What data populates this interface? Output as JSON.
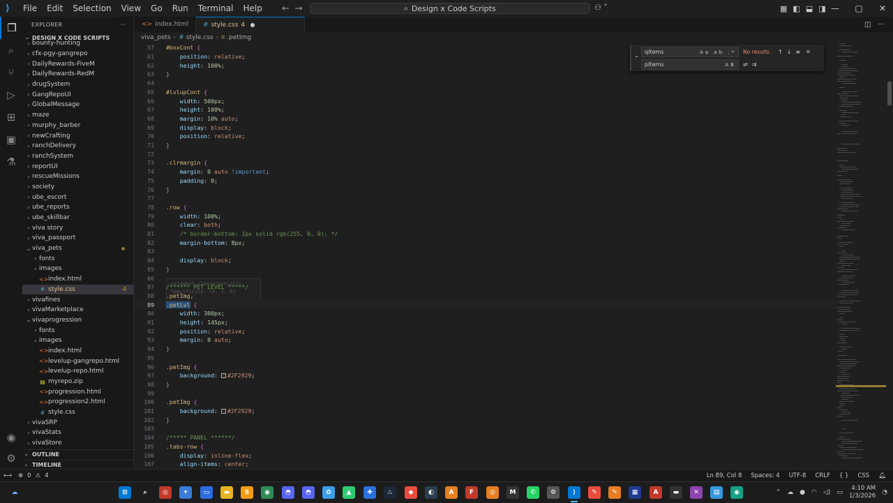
{
  "menu": [
    "File",
    "Edit",
    "Selection",
    "View",
    "Go",
    "Run",
    "Terminal",
    "Help"
  ],
  "command_center": "Design x Code Scripts",
  "explorer": {
    "title": "EXPLORER",
    "root": "DESIGN X CODE SCRIPTS",
    "items": [
      {
        "label": "bounty-hunting",
        "kind": "folder",
        "depth": 1
      },
      {
        "label": "cfx-pgy-gangrepo",
        "kind": "folder",
        "depth": 1
      },
      {
        "label": "DailyRewards-FiveM",
        "kind": "folder",
        "depth": 1
      },
      {
        "label": "DailyRewards-RedM",
        "kind": "folder",
        "depth": 1
      },
      {
        "label": "drugSystem",
        "kind": "folder",
        "depth": 1
      },
      {
        "label": "GangRepoUI",
        "kind": "folder",
        "depth": 1
      },
      {
        "label": "GlobalMessage",
        "kind": "folder",
        "depth": 1
      },
      {
        "label": "maze",
        "kind": "folder",
        "depth": 1
      },
      {
        "label": "murphy_barber",
        "kind": "folder",
        "depth": 1
      },
      {
        "label": "newCrafting",
        "kind": "folder",
        "depth": 1
      },
      {
        "label": "ranchDelivery",
        "kind": "folder",
        "depth": 1
      },
      {
        "label": "ranchSystem",
        "kind": "folder",
        "depth": 1
      },
      {
        "label": "reportUI",
        "kind": "folder",
        "depth": 1
      },
      {
        "label": "rescueMissions",
        "kind": "folder",
        "depth": 1
      },
      {
        "label": "society",
        "kind": "folder",
        "depth": 1
      },
      {
        "label": "ube_escort",
        "kind": "folder",
        "depth": 1
      },
      {
        "label": "ube_reports",
        "kind": "folder",
        "depth": 1
      },
      {
        "label": "ube_skillbar",
        "kind": "folder",
        "depth": 1
      },
      {
        "label": "viva story",
        "kind": "folder",
        "depth": 1
      },
      {
        "label": "viva_passport",
        "kind": "folder",
        "depth": 1
      },
      {
        "label": "viva_pets",
        "kind": "folder-open",
        "depth": 1,
        "dot": true
      },
      {
        "label": "fonts",
        "kind": "folder",
        "depth": 2
      },
      {
        "label": "images",
        "kind": "folder",
        "depth": 2
      },
      {
        "label": "index.html",
        "kind": "html",
        "depth": 2
      },
      {
        "label": "style.css",
        "kind": "css",
        "depth": 2,
        "selected": true,
        "badge": "4"
      },
      {
        "label": "vivafines",
        "kind": "folder",
        "depth": 1
      },
      {
        "label": "vivaMarketplace",
        "kind": "folder",
        "depth": 1
      },
      {
        "label": "vivaprogression",
        "kind": "folder-open",
        "depth": 1
      },
      {
        "label": "fonts",
        "kind": "folder",
        "depth": 2
      },
      {
        "label": "images",
        "kind": "folder",
        "depth": 2
      },
      {
        "label": "index.html",
        "kind": "html",
        "depth": 2
      },
      {
        "label": "levelup-gangrepo.html",
        "kind": "html",
        "depth": 2
      },
      {
        "label": "levelup-repo.html",
        "kind": "html",
        "depth": 2
      },
      {
        "label": "myrepo.zip",
        "kind": "zip",
        "depth": 2
      },
      {
        "label": "progression.html",
        "kind": "html",
        "depth": 2
      },
      {
        "label": "progression2.html",
        "kind": "html",
        "depth": 2
      },
      {
        "label": "style.css",
        "kind": "css",
        "depth": 2
      },
      {
        "label": "vivaSRP",
        "kind": "folder",
        "depth": 1
      },
      {
        "label": "vivaStats",
        "kind": "folder",
        "depth": 1
      },
      {
        "label": "vivaStore",
        "kind": "folder",
        "depth": 1
      }
    ],
    "outline": "OUTLINE",
    "timeline": "TIMELINE"
  },
  "tabs": [
    {
      "label": "index.html",
      "active": false
    },
    {
      "label": "style.css",
      "badge": "4",
      "active": true
    }
  ],
  "breadcrumb": [
    "viva_pets",
    "style.css",
    ".petImg"
  ],
  "find": {
    "query": "qItems",
    "replace": "pItems",
    "status": "No results",
    "find_opts": "Aa ab .*",
    "replace_opts": "AB"
  },
  "hover": {
    "line1": "<element class=\"petLvl\">",
    "line2": "Specificity: (0, 1, 0)"
  },
  "code": [
    {
      "n": "57",
      "t": [
        [
          "sel",
          "#boxCont "
        ],
        [
          "brace",
          "{"
        ]
      ]
    },
    {
      "n": "61",
      "t": [
        [
          "plain",
          "    "
        ],
        [
          "prop",
          "position"
        ],
        [
          "plain",
          ": "
        ],
        [
          "val",
          "relative"
        ],
        [
          "plain",
          ";"
        ]
      ]
    },
    {
      "n": "62",
      "t": [
        [
          "plain",
          "    "
        ],
        [
          "prop",
          "height"
        ],
        [
          "plain",
          ": "
        ],
        [
          "num",
          "100%"
        ],
        [
          "plain",
          ";"
        ]
      ]
    },
    {
      "n": "63",
      "t": [
        [
          "brace",
          "}"
        ]
      ]
    },
    {
      "n": "64",
      "t": []
    },
    {
      "n": "65",
      "t": [
        [
          "sel",
          "#lvlupCont "
        ],
        [
          "brace",
          "{"
        ]
      ]
    },
    {
      "n": "66",
      "t": [
        [
          "plain",
          "    "
        ],
        [
          "prop",
          "width"
        ],
        [
          "plain",
          ": "
        ],
        [
          "num",
          "500px"
        ],
        [
          "plain",
          ";"
        ]
      ]
    },
    {
      "n": "67",
      "t": [
        [
          "plain",
          "    "
        ],
        [
          "prop",
          "height"
        ],
        [
          "plain",
          ": "
        ],
        [
          "num",
          "100%"
        ],
        [
          "plain",
          ";"
        ]
      ]
    },
    {
      "n": "68",
      "t": [
        [
          "plain",
          "    "
        ],
        [
          "prop",
          "margin"
        ],
        [
          "plain",
          ": "
        ],
        [
          "num",
          "10%"
        ],
        [
          "plain",
          " "
        ],
        [
          "val",
          "auto"
        ],
        [
          "plain",
          ";"
        ]
      ]
    },
    {
      "n": "69",
      "t": [
        [
          "plain",
          "    "
        ],
        [
          "prop",
          "display"
        ],
        [
          "plain",
          ": "
        ],
        [
          "val",
          "block"
        ],
        [
          "plain",
          ";"
        ]
      ]
    },
    {
      "n": "70",
      "t": [
        [
          "plain",
          "    "
        ],
        [
          "prop",
          "position"
        ],
        [
          "plain",
          ": "
        ],
        [
          "val",
          "relative"
        ],
        [
          "plain",
          ";"
        ]
      ]
    },
    {
      "n": "71",
      "t": [
        [
          "brace",
          "}"
        ]
      ]
    },
    {
      "n": "72",
      "t": []
    },
    {
      "n": "73",
      "t": [
        [
          "sel",
          ".clrmargin "
        ],
        [
          "brace",
          "{"
        ]
      ]
    },
    {
      "n": "74",
      "t": [
        [
          "plain",
          "    "
        ],
        [
          "prop",
          "margin"
        ],
        [
          "plain",
          ": "
        ],
        [
          "num",
          "0"
        ],
        [
          "plain",
          " "
        ],
        [
          "val",
          "auto"
        ],
        [
          "plain",
          " "
        ],
        [
          "kw",
          "!important"
        ],
        [
          "plain",
          ";"
        ]
      ]
    },
    {
      "n": "75",
      "t": [
        [
          "plain",
          "    "
        ],
        [
          "prop",
          "padding"
        ],
        [
          "plain",
          ": "
        ],
        [
          "num",
          "0"
        ],
        [
          "plain",
          ";"
        ]
      ]
    },
    {
      "n": "76",
      "t": [
        [
          "brace",
          "}"
        ]
      ]
    },
    {
      "n": "77",
      "t": []
    },
    {
      "n": "78",
      "t": [
        [
          "sel",
          ".row "
        ],
        [
          "brace",
          "{"
        ]
      ]
    },
    {
      "n": "79",
      "t": [
        [
          "plain",
          "    "
        ],
        [
          "prop",
          "width"
        ],
        [
          "plain",
          ": "
        ],
        [
          "num",
          "100%"
        ],
        [
          "plain",
          ";"
        ]
      ]
    },
    {
      "n": "80",
      "t": [
        [
          "plain",
          "    "
        ],
        [
          "prop",
          "clear"
        ],
        [
          "plain",
          ": "
        ],
        [
          "val",
          "both"
        ],
        [
          "plain",
          ";"
        ]
      ]
    },
    {
      "n": "81",
      "t": [
        [
          "plain",
          "    "
        ],
        [
          "com",
          "/* border-bottom: 1px solid rgb(255, 0, 0); */"
        ]
      ]
    },
    {
      "n": "82",
      "t": [
        [
          "plain",
          "    "
        ],
        [
          "prop",
          "margin-bottom"
        ],
        [
          "plain",
          ": "
        ],
        [
          "num",
          "8px"
        ],
        [
          "plain",
          ";"
        ]
      ]
    },
    {
      "n": "83",
      "t": []
    },
    {
      "n": "84",
      "t": [
        [
          "plain",
          "    "
        ],
        [
          "prop",
          "display"
        ],
        [
          "plain",
          ": "
        ],
        [
          "val",
          "block"
        ],
        [
          "plain",
          ";"
        ]
      ]
    },
    {
      "n": "85",
      "t": [
        [
          "brace",
          "}"
        ]
      ]
    },
    {
      "n": "86",
      "t": []
    },
    {
      "n": "87",
      "t": [
        [
          "com",
          "/****** PET LEVEL *****/"
        ]
      ]
    },
    {
      "n": "88",
      "t": [
        [
          "sel",
          ".petImg"
        ],
        [
          "plain",
          ","
        ]
      ]
    },
    {
      "n": "89",
      "t": [
        [
          "hlsel",
          ".petLvl"
        ],
        [
          "plain",
          " "
        ],
        [
          "brace",
          "{"
        ]
      ],
      "cur": true
    },
    {
      "n": "90",
      "t": [
        [
          "plain",
          "    "
        ],
        [
          "prop",
          "width"
        ],
        [
          "plain",
          ": "
        ],
        [
          "num",
          "300px"
        ],
        [
          "plain",
          ";"
        ]
      ]
    },
    {
      "n": "91",
      "t": [
        [
          "plain",
          "    "
        ],
        [
          "prop",
          "height"
        ],
        [
          "plain",
          ": "
        ],
        [
          "num",
          "145px"
        ],
        [
          "plain",
          ";"
        ]
      ]
    },
    {
      "n": "92",
      "t": [
        [
          "plain",
          "    "
        ],
        [
          "prop",
          "position"
        ],
        [
          "plain",
          ": "
        ],
        [
          "val",
          "relative"
        ],
        [
          "plain",
          ";"
        ]
      ]
    },
    {
      "n": "93",
      "t": [
        [
          "plain",
          "    "
        ],
        [
          "prop",
          "margin"
        ],
        [
          "plain",
          ": "
        ],
        [
          "num",
          "0"
        ],
        [
          "plain",
          " "
        ],
        [
          "val",
          "auto"
        ],
        [
          "plain",
          ";"
        ]
      ]
    },
    {
      "n": "94",
      "t": [
        [
          "brace",
          "}"
        ]
      ]
    },
    {
      "n": "95",
      "t": []
    },
    {
      "n": "96",
      "t": [
        [
          "sel",
          ".petImg "
        ],
        [
          "brace",
          "{"
        ]
      ]
    },
    {
      "n": "97",
      "t": [
        [
          "plain",
          "    "
        ],
        [
          "prop",
          "background"
        ],
        [
          "plain",
          ": "
        ],
        [
          "swatch",
          ""
        ],
        [
          "val",
          "#2F2929"
        ],
        [
          "plain",
          ";"
        ]
      ]
    },
    {
      "n": "98",
      "t": [
        [
          "brace",
          "}"
        ]
      ]
    },
    {
      "n": "99",
      "t": []
    },
    {
      "n": "100",
      "t": [
        [
          "sel",
          ".petImg "
        ],
        [
          "brace",
          "{"
        ]
      ]
    },
    {
      "n": "101",
      "t": [
        [
          "plain",
          "    "
        ],
        [
          "prop",
          "background"
        ],
        [
          "plain",
          ": "
        ],
        [
          "swatch",
          ""
        ],
        [
          "val",
          "#2F2929"
        ],
        [
          "plain",
          ";"
        ]
      ]
    },
    {
      "n": "102",
      "t": [
        [
          "brace",
          "}"
        ]
      ]
    },
    {
      "n": "103",
      "t": []
    },
    {
      "n": "104",
      "t": [
        [
          "com",
          "/***** PANEL ******/"
        ]
      ]
    },
    {
      "n": "105",
      "t": [
        [
          "sel",
          ".tabs-row "
        ],
        [
          "brace",
          "{"
        ]
      ]
    },
    {
      "n": "106",
      "t": [
        [
          "plain",
          "    "
        ],
        [
          "prop",
          "display"
        ],
        [
          "plain",
          ": "
        ],
        [
          "val",
          "inline-flex"
        ],
        [
          "plain",
          ";"
        ]
      ]
    },
    {
      "n": "107",
      "t": [
        [
          "plain",
          "    "
        ],
        [
          "prop",
          "align-items"
        ],
        [
          "plain",
          ": "
        ],
        [
          "val",
          "center"
        ],
        [
          "plain",
          ";"
        ]
      ]
    }
  ],
  "status": {
    "errors": "0",
    "warnings": "4",
    "position": "Ln 89, Col 8",
    "spaces": "Spaces: 4",
    "encoding": "UTF-8",
    "eol": "CRLF",
    "language": "CSS"
  },
  "clock": {
    "time": "4:10 AM",
    "date": "1/3/2026"
  }
}
